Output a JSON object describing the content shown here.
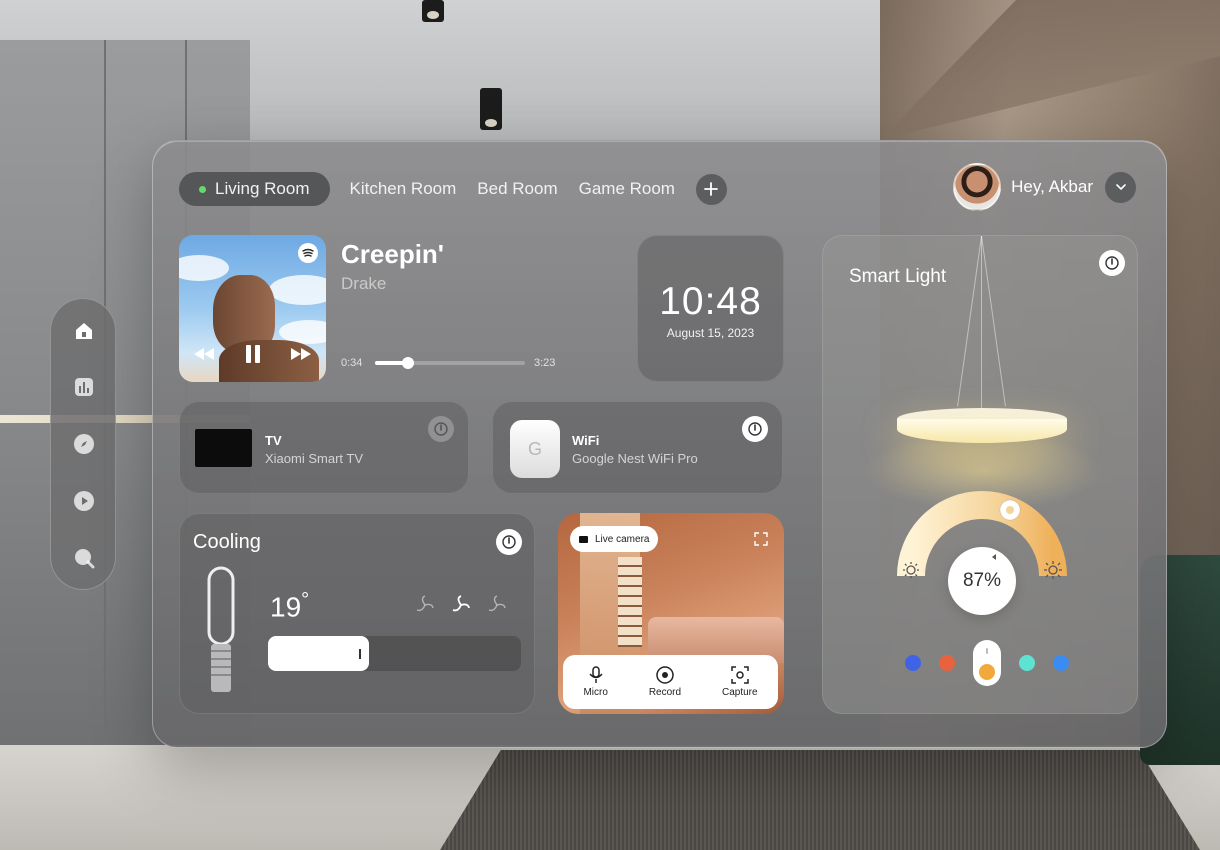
{
  "tabs": {
    "items": [
      "Living Room",
      "Kitchen Room",
      "Bed Room",
      "Game Room"
    ],
    "active": "Living Room",
    "add_icon": "plus-icon"
  },
  "user": {
    "greeting": "Hey, Akbar",
    "menu_icon": "chevron-down-icon"
  },
  "music": {
    "title": "Creepin'",
    "artist": "Drake",
    "elapsed": "0:34",
    "total": "3:23",
    "progress": 0.22,
    "service_icon": "spotify-icon"
  },
  "clock": {
    "time": "10:48",
    "date": "August 15, 2023"
  },
  "tv": {
    "title": "TV",
    "subtitle": "Xiaomi Smart TV",
    "power_on": false
  },
  "wifi": {
    "title": "WiFi",
    "subtitle": "Google Nest WiFi Pro",
    "device_letter": "G",
    "power_on": true
  },
  "cooling": {
    "title": "Cooling",
    "temperature": "19",
    "degree": "°",
    "fan_speed_level": 0.4
  },
  "camera": {
    "live_label": "Live camera",
    "actions": [
      {
        "label": "Micro",
        "icon": "microphone-icon"
      },
      {
        "label": "Record",
        "icon": "record-icon"
      },
      {
        "label": "Capture",
        "icon": "capture-icon"
      }
    ]
  },
  "light": {
    "title": "Smart Light",
    "brightness": "87%",
    "colors": [
      "#3f63e6",
      "#e8633d",
      "#f2a93b",
      "#5ee3d3",
      "#3b8cf0"
    ],
    "selected_color": "#f2a93b"
  },
  "sidebar": {
    "items": [
      "home-icon",
      "stats-icon",
      "compass-icon",
      "play-icon",
      "search-icon"
    ],
    "active": "home-icon"
  },
  "colors": {
    "active_dot": "#5fdc6a",
    "panel": "#78787a",
    "accent_warm": "#f2c98a"
  }
}
